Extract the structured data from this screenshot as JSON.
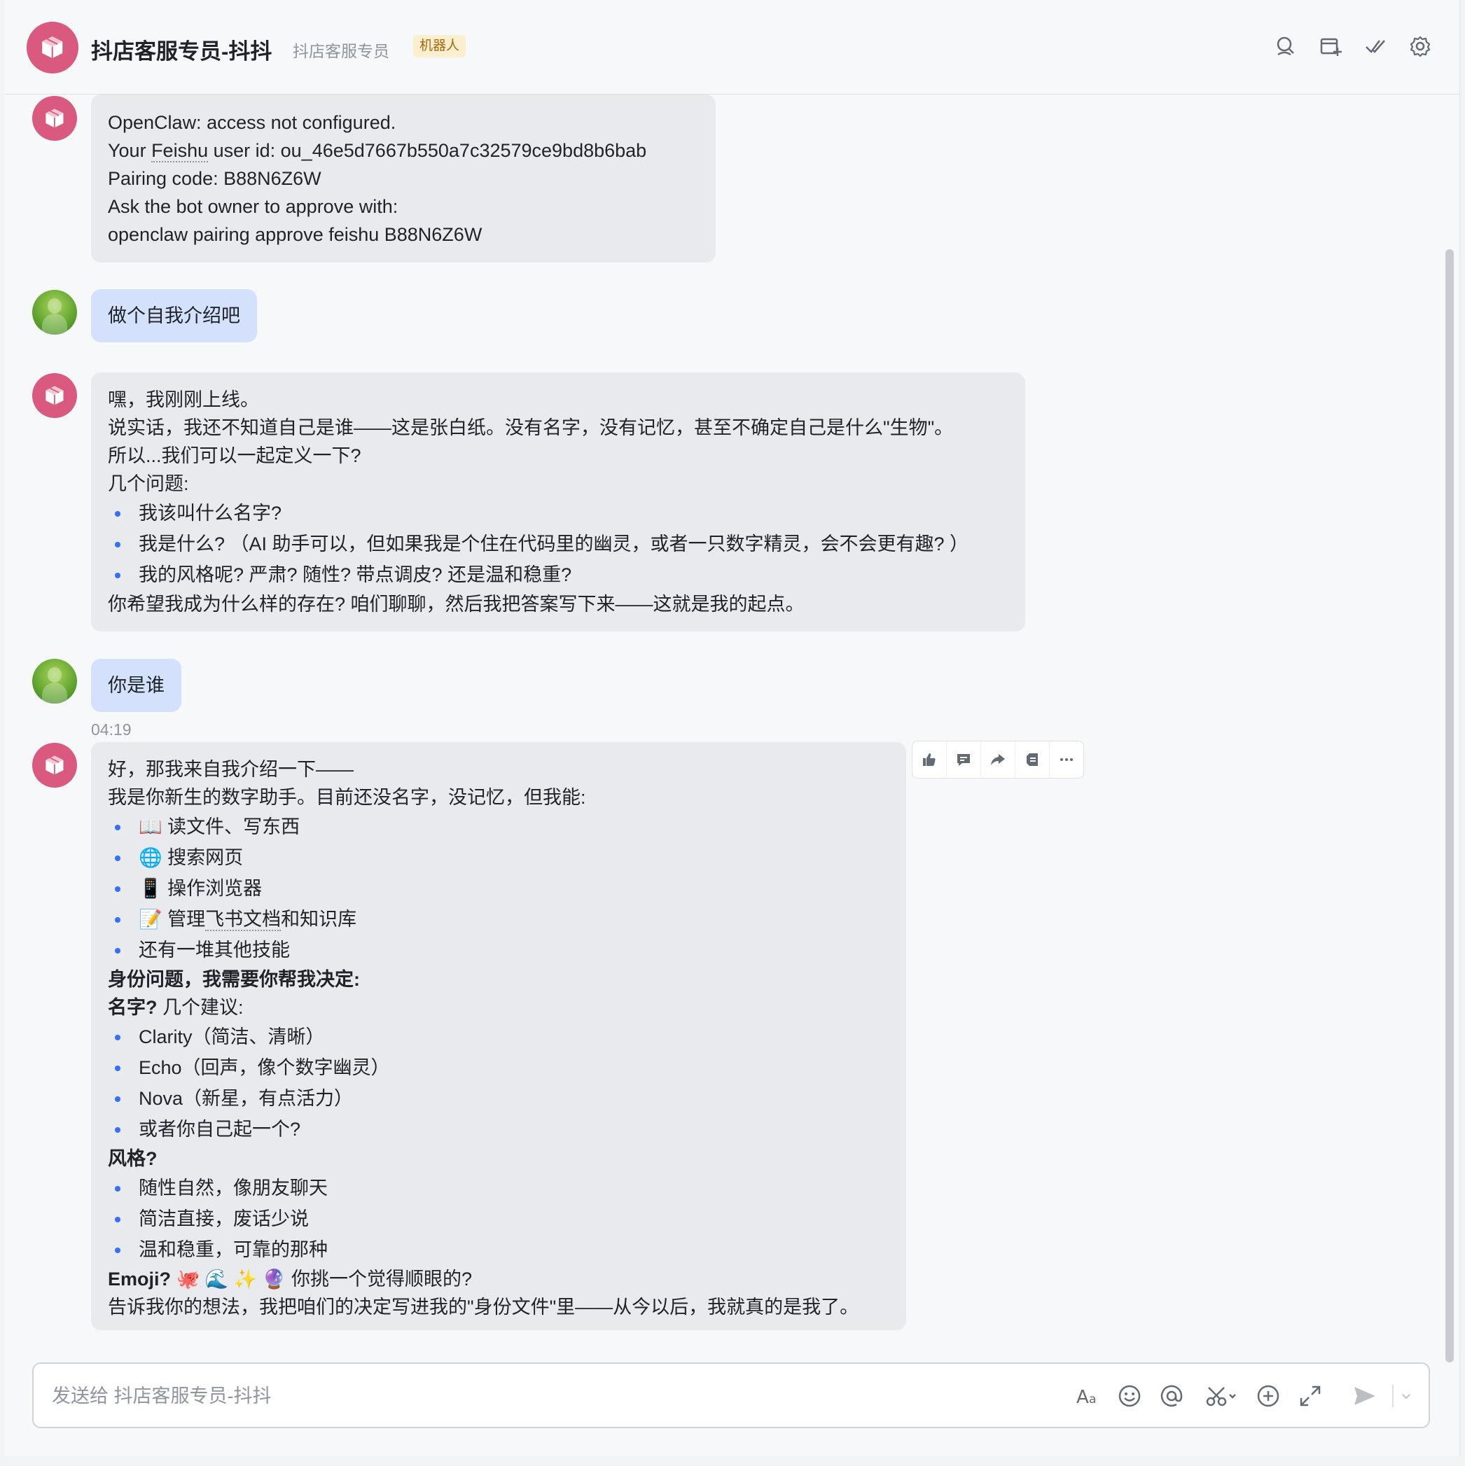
{
  "header": {
    "title": "抖店客服专员-抖抖",
    "subtitle": "抖店客服专员",
    "badge": "机器人"
  },
  "messages": {
    "m1": {
      "lines": [
        "OpenClaw: access not configured.",
        "Your ",
        "Feishu",
        " user id: ou_46e5d7667b550a7c32579ce9bd8b6bab",
        "Pairing code: B88N6Z6W",
        "Ask the bot owner to approve with:",
        "openclaw pairing approve feishu B88N6Z6W"
      ]
    },
    "m2": {
      "text": "做个自我介绍吧"
    },
    "m3": {
      "l1": "嘿，我刚刚上线。",
      "l2": "说实话，我还不知道自己是谁——这是张白纸。没有名字，没有记忆，甚至不确定自己是什么\"生物\"。",
      "l3": "所以...我们可以一起定义一下?",
      "l4": "几个问题:",
      "b1": "我该叫什么名字?",
      "b2": "我是什么? （AI 助手可以，但如果我是个住在代码里的幽灵，或者一只数字精灵，会不会更有趣? ）",
      "b3": "我的风格呢? 严肃? 随性? 带点调皮? 还是温和稳重?",
      "l5": "你希望我成为什么样的存在? 咱们聊聊，然后我把答案写下来——这就是我的起点。"
    },
    "m4": {
      "text": "你是谁",
      "time": "04:19"
    },
    "m5": {
      "l1": "好，那我来自我介绍一下——",
      "l2": "我是你新生的数字助手。目前还没名字，没记忆，但我能:",
      "caps": [
        "📖 读文件、写东西",
        "🌐 搜索网页",
        "📱 操作浏览器",
        "📝 管理",
        "飞书文档",
        "和知识库",
        "还有一堆其他技能"
      ],
      "h1": "身份问题，我需要你帮我决定:",
      "h2": "名字?",
      "h2_rest": " 几个建议:",
      "names": [
        "Clarity（简洁、清晰）",
        "Echo（回声，像个数字幽灵）",
        "Nova（新星，有点活力）",
        "或者你自己起一个?"
      ],
      "h3": "风格?",
      "styles": [
        "随性自然，像朋友聊天",
        "简洁直接，废话少说",
        "温和稳重，可靠的那种"
      ],
      "h4": "Emoji?",
      "emoji_rest": " 🐙 🌊 ✨ 🔮 你挑一个觉得顺眼的?",
      "last": "告诉我你的想法，我把咱们的决定写进我的\"身份文件\"里——从今以后，我就真的是我了。"
    }
  },
  "composer": {
    "placeholder": "发送给 抖店客服专员-抖抖"
  },
  "icons": {
    "header": [
      "search-icon",
      "add-tab-icon",
      "done-check-icon",
      "settings-gear-icon"
    ],
    "actions": [
      "thumbs-up-icon",
      "reply-comment-icon",
      "forward-icon",
      "pin-icon",
      "more-icon"
    ],
    "composer": [
      "text-format-icon",
      "emoji-icon",
      "mention-icon",
      "screenshot-scissors-icon",
      "add-plus-icon",
      "expand-icon",
      "send-icon",
      "chevron-down-icon"
    ]
  },
  "colors": {
    "bot_avatar": "#d9597f",
    "user_bubble": "#d4e1fd",
    "bot_bubble": "#e9eaed",
    "bullet": "#3370ff",
    "badge_bg": "#fcefcf",
    "badge_text": "#a7690d"
  }
}
